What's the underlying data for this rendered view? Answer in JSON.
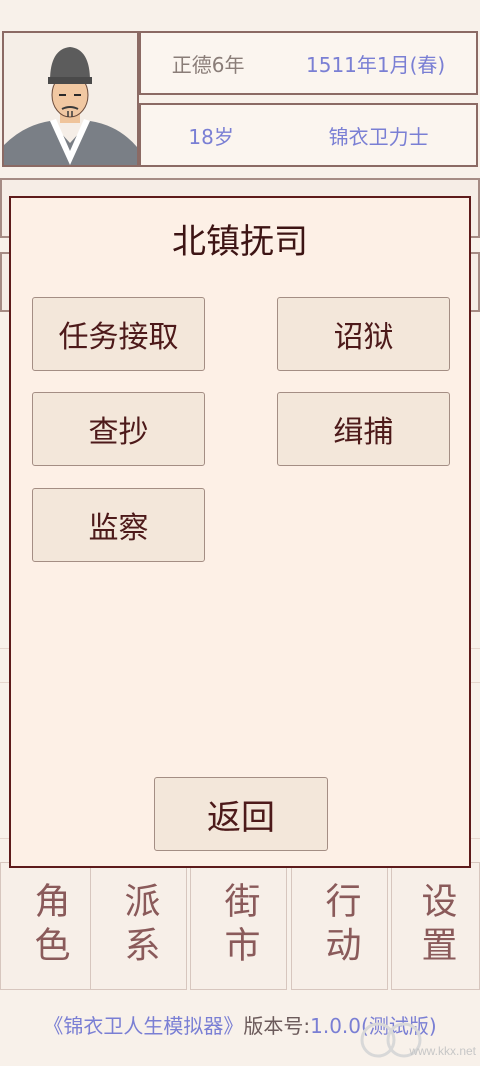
{
  "header": {
    "era": "正德6年",
    "date": "1511年1月(春)",
    "age": "18岁",
    "rank": "锦衣卫力士"
  },
  "modal": {
    "title": "北镇抚司",
    "buttons": [
      "任务接取",
      "诏狱",
      "查抄",
      "缉捕",
      "监察"
    ],
    "back_label": "返回"
  },
  "nav": [
    "角色",
    "派系",
    "街市",
    "行动",
    "设置"
  ],
  "footer": {
    "game_title": "《锦衣卫人生模拟器》",
    "version_label": "版本号:",
    "version_value": "1.0.0(测试版)"
  },
  "watermark": {
    "site": "www.kkx.net"
  },
  "colors": {
    "accent_blue": "#7a7fd4",
    "modal_border": "#5e1b1b",
    "background": "#f8f1ea"
  }
}
